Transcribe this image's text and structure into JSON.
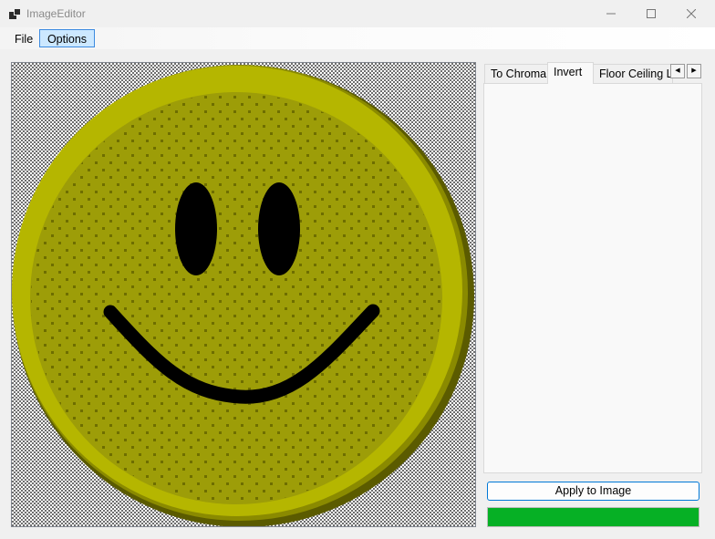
{
  "window": {
    "title": "ImageEditor",
    "controls": {
      "minimize_icon": "minimize-icon",
      "maximize_icon": "maximize-icon",
      "close_icon": "close-icon"
    }
  },
  "menu": {
    "items": [
      {
        "label": "File",
        "selected": false
      },
      {
        "label": "Options",
        "selected": true
      }
    ]
  },
  "canvas": {
    "image": "smiley-face",
    "background": "transparency-checkerboard",
    "colors": {
      "face": "#9d9d08",
      "highlight": "#b5b600",
      "shadow": "#5b5b00",
      "features": "#000000"
    }
  },
  "tabs": {
    "items": [
      {
        "label": "To Chroma",
        "active": false
      },
      {
        "label": "Invert",
        "active": true
      },
      {
        "label": "Floor Ceiling Lu",
        "active": false
      }
    ],
    "scroll_left_icon": "chevron-left-icon",
    "scroll_right_icon": "chevron-right-icon"
  },
  "apply_button": {
    "label": "Apply to Image"
  },
  "progress": {
    "value": 1.0,
    "color": "#06b025"
  }
}
